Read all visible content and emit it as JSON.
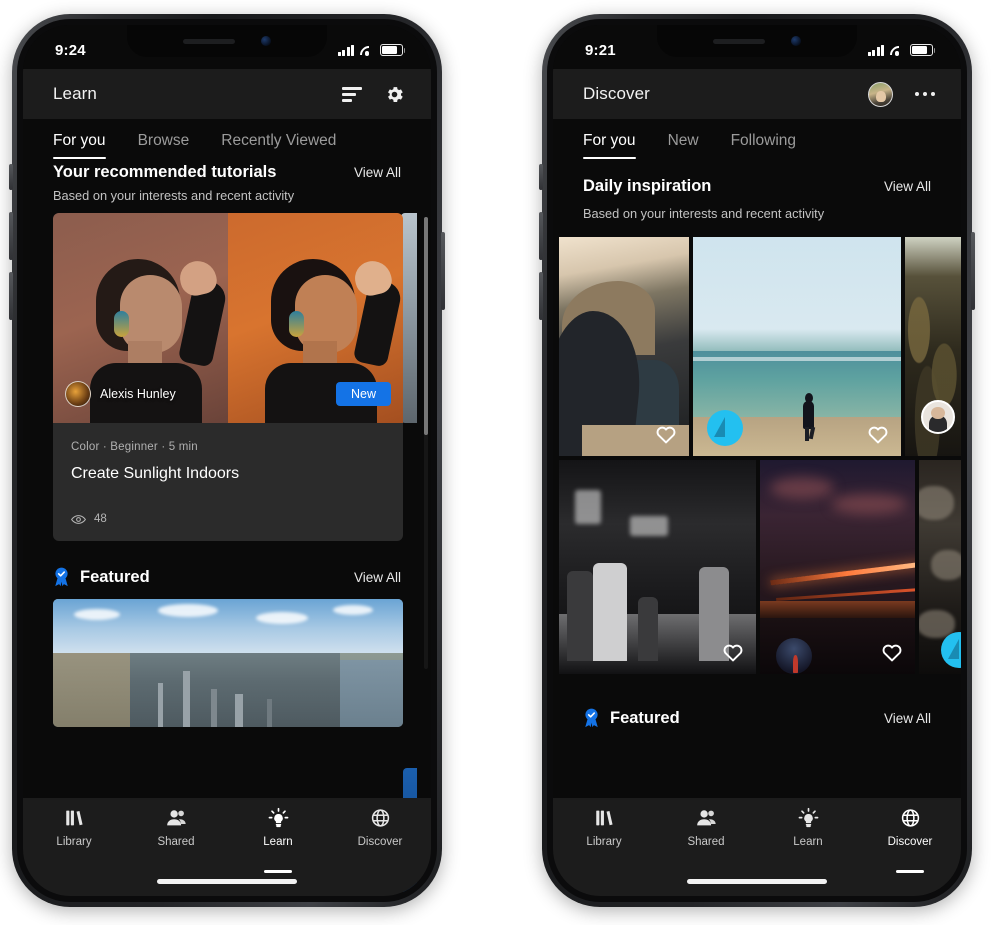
{
  "phones": [
    {
      "id": "learn-phone",
      "status_bar": {
        "time": "9:24",
        "signal_icon": "cellular-bars-icon",
        "wifi_icon": "wifi-icon",
        "battery_icon": "battery-icon"
      },
      "app_bar": {
        "title": "Learn",
        "actions": [
          {
            "name": "sort-filter-icon",
            "label": "Sort"
          },
          {
            "name": "settings-gear-icon",
            "label": "Settings"
          }
        ]
      },
      "tabs": [
        {
          "label": "For you",
          "active": true
        },
        {
          "label": "Browse",
          "active": false
        },
        {
          "label": "Recently Viewed",
          "active": false
        }
      ],
      "sections": [
        {
          "title": "Your recommended tutorials",
          "action": "View All",
          "subtitle": "Based on your interests and recent activity",
          "badge": null
        },
        {
          "title": "Featured",
          "action": "View All",
          "subtitle": null,
          "badge": "featured-ribbon-icon"
        }
      ],
      "tutorial_card": {
        "author": "Alexis Hunley",
        "badge": "New",
        "meta": "Color  ·  Beginner  ·  5 min",
        "title": "Create Sunlight Indoors",
        "views": "48",
        "views_icon": "eye-icon",
        "new_badge_color": "#1473e6"
      },
      "bottom_nav": [
        {
          "label": "Library",
          "icon": "books-icon",
          "active": false
        },
        {
          "label": "Shared",
          "icon": "people-icon",
          "active": false
        },
        {
          "label": "Learn",
          "icon": "lightbulb-icon",
          "active": true
        },
        {
          "label": "Discover",
          "icon": "globe-icon",
          "active": false
        }
      ]
    },
    {
      "id": "discover-phone",
      "status_bar": {
        "time": "9:21",
        "signal_icon": "cellular-bars-icon",
        "wifi_icon": "wifi-icon",
        "battery_icon": "battery-icon"
      },
      "app_bar": {
        "title": "Discover",
        "actions": [
          {
            "name": "profile-avatar",
            "label": "Profile"
          },
          {
            "name": "overflow-menu-icon",
            "label": "More"
          }
        ]
      },
      "tabs": [
        {
          "label": "For you",
          "active": true
        },
        {
          "label": "New",
          "active": false
        },
        {
          "label": "Following",
          "active": false
        }
      ],
      "sections": [
        {
          "title": "Daily inspiration",
          "action": "View All",
          "subtitle": "Based on your interests and recent activity",
          "badge": null
        },
        {
          "title": "Featured",
          "action": "View All",
          "subtitle": null,
          "badge": "featured-ribbon-icon"
        }
      ],
      "grid": {
        "rows": [
          {
            "cells": [
              {
                "art": "cliff",
                "like_icon": "heart-outline-icon",
                "overlay": null
              },
              {
                "art": "beach",
                "like_icon": "heart-outline-icon",
                "overlay": "lightroom-logo-badge"
              },
              {
                "art": "forest",
                "like_icon": null,
                "overlay": "author-avatar"
              }
            ]
          },
          {
            "cells": [
              {
                "art": "street",
                "like_icon": "heart-outline-icon",
                "overlay": null
              },
              {
                "art": "night",
                "like_icon": "heart-outline-icon",
                "overlay": "mini-photo-badge"
              },
              {
                "art": "rocks",
                "like_icon": null,
                "overlay": "lightroom-logo-badge"
              }
            ]
          }
        ]
      },
      "bottom_nav": [
        {
          "label": "Library",
          "icon": "books-icon",
          "active": false
        },
        {
          "label": "Shared",
          "icon": "people-icon",
          "active": false
        },
        {
          "label": "Learn",
          "icon": "lightbulb-icon",
          "active": false
        },
        {
          "label": "Discover",
          "icon": "globe-icon",
          "active": true
        }
      ]
    }
  ],
  "colors": {
    "accent_blue": "#1473e6",
    "logo_cyan": "#23c0f0",
    "screen_bg": "#0a0a0a",
    "bar_bg": "#1c1c1c",
    "card_bg": "#2b2b2b",
    "page_bg": "#ffffff"
  }
}
